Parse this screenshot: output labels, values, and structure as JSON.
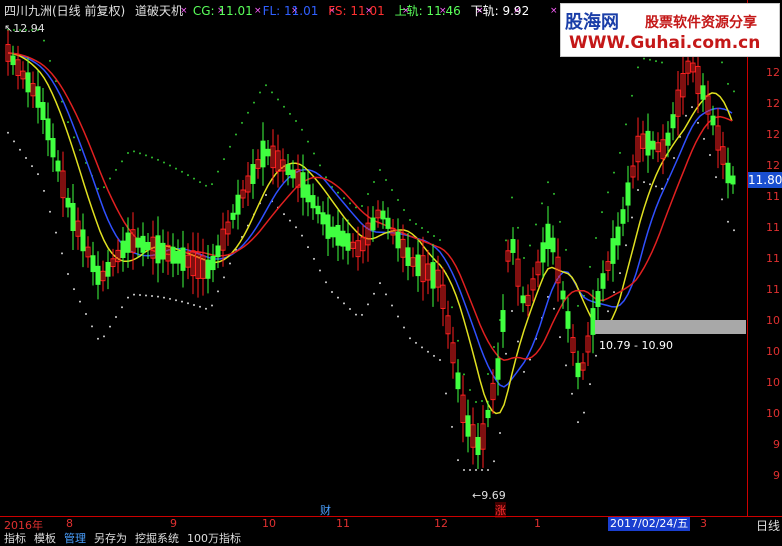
{
  "header": {
    "title": "四川九洲(日线 前复权)",
    "indicator": "道破天机",
    "cg": "CG: 11.01",
    "fl": "FL: 11.01",
    "fs": "FS: 11.01",
    "upper": "上轨: 11.46",
    "lower": "下轨: 9.92"
  },
  "marks": {
    "high": "12.94",
    "low": "9.69",
    "cai": "财",
    "zhang": "涨"
  },
  "price_axis": {
    "ticks": [
      "12",
      "12",
      "12",
      "12",
      "11",
      "11",
      "11",
      "11",
      "10",
      "10",
      "10",
      "10",
      "9",
      "9"
    ],
    "current": "11.80"
  },
  "range_label": "10.79 - 10.90",
  "time_axis": {
    "labels": [
      "2016年",
      "8",
      "9",
      "10",
      "11",
      "12",
      "1",
      "3"
    ],
    "selected_date": "2017/02/24/五",
    "period": "日线"
  },
  "menu": {
    "items": [
      "指标",
      "模板",
      "管理",
      "另存为",
      "挖掘系统",
      "100万指标"
    ],
    "active_index": 2
  },
  "logo": {
    "line1": "股海网",
    "line2": "股票软件资源分享",
    "line3": "WWW.Guhai.com.cn"
  },
  "colors": {
    "up": "#ff2020",
    "down": "#40ff40",
    "ma_blue": "#3050ff",
    "ma_yellow": "#e0e020",
    "ma_red": "#e02020",
    "dots_green": "#30c030",
    "dots_white": "#d0d0d0",
    "header_cg": "#5aff5a",
    "header_fl": "#3060ff",
    "header_fs": "#ff3030",
    "header_upper": "#5aff5a",
    "header_lower": "#ffffff"
  }
}
